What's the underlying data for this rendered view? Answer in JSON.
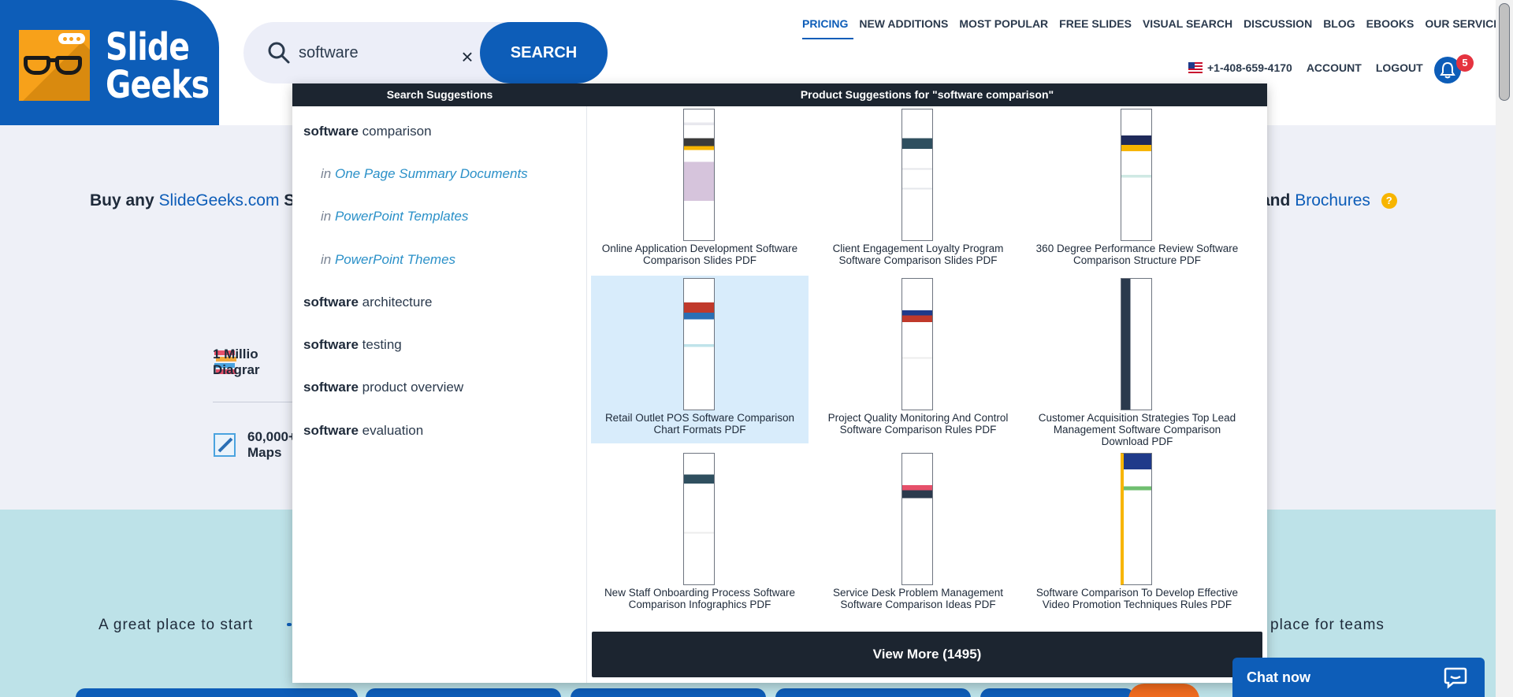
{
  "logo": {
    "line1": "Slide",
    "line2": "Geeks"
  },
  "search": {
    "value": "software",
    "clear_label": "×",
    "button_label": "SEARCH"
  },
  "nav": {
    "items": [
      {
        "label": "PRICING"
      },
      {
        "label": "NEW ADDITIONS"
      },
      {
        "label": "MOST POPULAR"
      },
      {
        "label": "FREE SLIDES"
      },
      {
        "label": "VISUAL SEARCH"
      },
      {
        "label": "DISCUSSION"
      },
      {
        "label": "BLOG"
      },
      {
        "label": "EBOOKS"
      },
      {
        "label": "OUR SERVICES"
      }
    ],
    "phone": "+1-408-659-4170",
    "account": "ACCOUNT",
    "logout": "LOGOUT",
    "notifications": "5"
  },
  "page": {
    "promo_bold": "Buy any",
    "promo_link": "SlideGeeks.com",
    "promo_tail": "S",
    "promo_right_bold": "and",
    "promo_right_link": "Brochures",
    "help": "?",
    "stat1_a": "1 Millio",
    "stat1_b": "Diagrar",
    "stat2_a": "60,000+",
    "stat2_b": "Maps",
    "teal_left": "A great place to start",
    "teal_right": "place for teams"
  },
  "dropdown": {
    "search_header": "Search Suggestions",
    "product_header": "Product Suggestions for \"software comparison\"",
    "suggestions": [
      {
        "bold": "software",
        "rest": " comparison"
      },
      {
        "bold": "software",
        "rest": " architecture"
      },
      {
        "bold": "software",
        "rest": " testing"
      },
      {
        "bold": "software",
        "rest": " product overview"
      },
      {
        "bold": "software",
        "rest": " evaluation"
      }
    ],
    "sub_suggestions": [
      {
        "prefix": "in ",
        "link": "One Page Summary Documents"
      },
      {
        "prefix": "in ",
        "link": "PowerPoint Templates"
      },
      {
        "prefix": "in ",
        "link": "PowerPoint Themes"
      }
    ],
    "products": [
      {
        "title": "Online Application Development Software Comparison Slides PDF"
      },
      {
        "title": "Client Engagement Loyalty Program Software Comparison Slides PDF"
      },
      {
        "title": "360 Degree Performance Review Software Comparison Structure PDF"
      },
      {
        "title": "Retail Outlet POS Software Comparison Chart Formats PDF"
      },
      {
        "title": "Project Quality Monitoring And Control Software Comparison Rules PDF"
      },
      {
        "title": "Customer Acquisition Strategies Top Lead Management Software Comparison Download PDF"
      },
      {
        "title": "New Staff Onboarding Process Software Comparison Infographics PDF"
      },
      {
        "title": "Service Desk Problem Management Software Comparison Ideas PDF"
      },
      {
        "title": "Software Comparison To Develop Effective Video Promotion Techniques Rules PDF"
      }
    ],
    "view_more": "View More (1495)"
  },
  "chat": {
    "label": "Chat now"
  },
  "colors": {
    "brand_blue": "#0d5db8",
    "dark": "#1c2530",
    "accent_orange": "#f7a11a"
  }
}
